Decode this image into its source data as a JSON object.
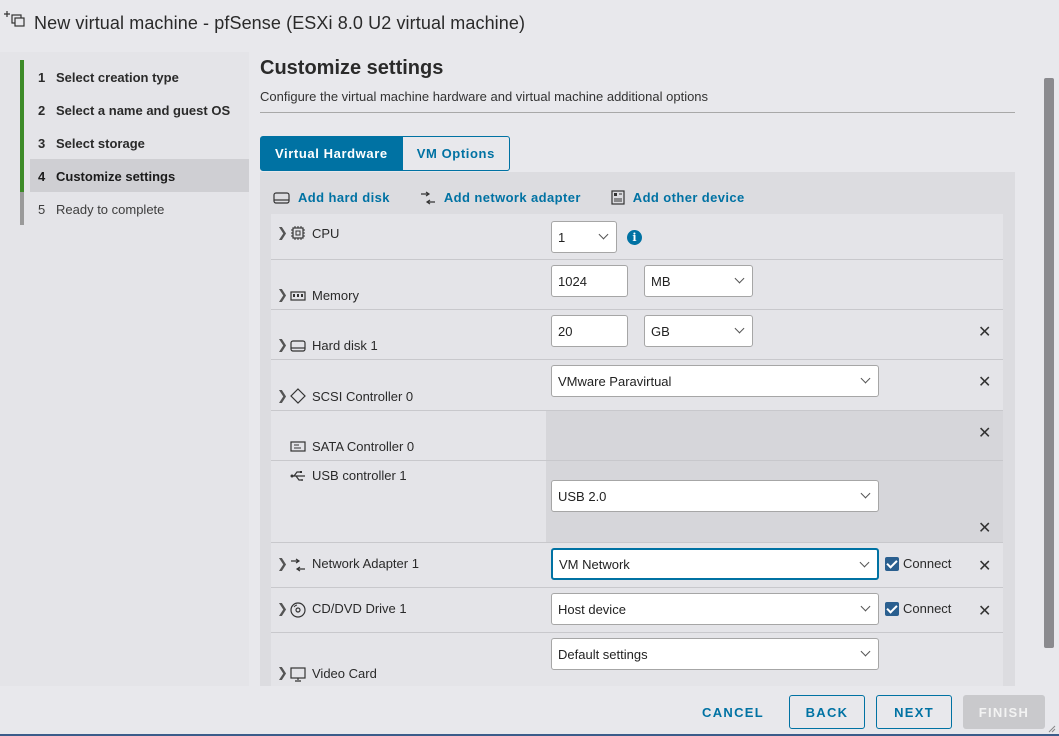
{
  "window": {
    "title": "New virtual machine - pfSense (ESXi 8.0 U2 virtual machine)"
  },
  "steps": [
    {
      "num": "1",
      "label": "Select creation type",
      "state": "done"
    },
    {
      "num": "2",
      "label": "Select a name and guest OS",
      "state": "done"
    },
    {
      "num": "3",
      "label": "Select storage",
      "state": "done"
    },
    {
      "num": "4",
      "label": "Customize settings",
      "state": "active"
    },
    {
      "num": "5",
      "label": "Ready to complete",
      "state": "pending"
    }
  ],
  "page": {
    "title": "Customize settings",
    "subtitle": "Configure the virtual machine hardware and virtual machine additional options"
  },
  "tabs": {
    "virtual_hardware": "Virtual Hardware",
    "vm_options": "VM Options"
  },
  "toolbar": {
    "add_hard_disk": "Add hard disk",
    "add_network_adapter": "Add network adapter",
    "add_other_device": "Add other device"
  },
  "hardware": {
    "cpu": {
      "label": "CPU",
      "value": "1",
      "info": "i"
    },
    "memory": {
      "label": "Memory",
      "value": "1024",
      "unit": "MB"
    },
    "hard_disk": {
      "label": "Hard disk 1",
      "value": "20",
      "unit": "GB"
    },
    "scsi": {
      "label": "SCSI Controller 0",
      "value": "VMware Paravirtual"
    },
    "sata": {
      "label": "SATA Controller 0"
    },
    "usb": {
      "label": "USB controller 1",
      "value": "USB 2.0"
    },
    "network": {
      "label": "Network Adapter 1",
      "value": "VM Network",
      "connect": "Connect"
    },
    "cdrom": {
      "label": "CD/DVD Drive 1",
      "value": "Host device",
      "connect": "Connect"
    },
    "video": {
      "label": "Video Card",
      "value": "Default settings"
    }
  },
  "footer": {
    "cancel": "CANCEL",
    "back": "BACK",
    "next": "NEXT",
    "finish": "FINISH"
  },
  "colors": {
    "accent": "#0072a3",
    "step_done": "#3d8b28"
  }
}
